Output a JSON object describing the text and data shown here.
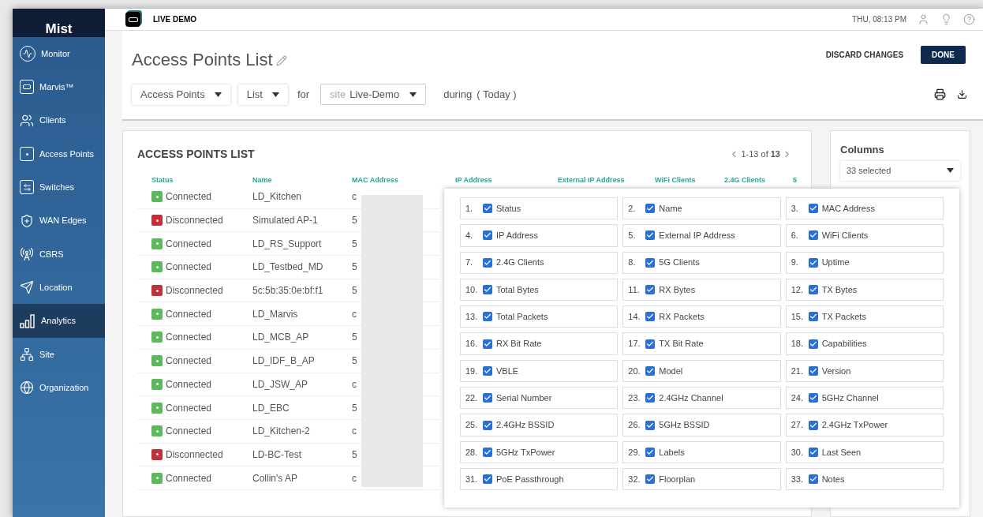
{
  "sidebar": {
    "logo": "Mist",
    "items": [
      {
        "label": "Monitor",
        "kind": "pulse",
        "selected": false
      },
      {
        "label": "Marvis™",
        "kind": "robot",
        "selected": false
      },
      {
        "label": "Clients",
        "kind": "users",
        "selected": false
      },
      {
        "label": "Access Points",
        "kind": "device",
        "selected": false
      },
      {
        "label": "Switches",
        "kind": "switch",
        "selected": false
      },
      {
        "label": "WAN Edges",
        "kind": "shield",
        "selected": false
      },
      {
        "label": "CBRS",
        "kind": "tower",
        "selected": false
      },
      {
        "label": "Location",
        "kind": "navigation",
        "selected": false
      },
      {
        "label": "Analytics",
        "kind": "bars",
        "selected": true
      },
      {
        "label": "Site",
        "kind": "sitemap",
        "selected": false
      },
      {
        "label": "Organization",
        "kind": "globe",
        "selected": false
      }
    ]
  },
  "header": {
    "org": "LIVE DEMO",
    "time": "THU, 08:13 PM"
  },
  "report": {
    "title": "Access Points List",
    "discard": "DISCARD CHANGES",
    "done": "DONE",
    "filters": [
      {
        "value": "Access Points"
      },
      {
        "value": "List"
      }
    ],
    "for": "for",
    "site_prefix": "site",
    "site": "Live-Demo",
    "during": "during",
    "period": "( Today )"
  },
  "table": {
    "title": "ACCESS POINTS LIST",
    "pager": "1-13 of",
    "total": "13",
    "columns": [
      "Status",
      "Name",
      "MAC Address",
      "IP Address",
      "External IP Address",
      "WiFi Clients",
      "2.4G Clients",
      "5"
    ],
    "rows": [
      {
        "status": "Connected",
        "online": true,
        "name": "LD_Kitchen",
        "mac": "c"
      },
      {
        "status": "Disconnected",
        "online": false,
        "name": "Simulated AP-1",
        "mac": "5"
      },
      {
        "status": "Connected",
        "online": true,
        "name": "LD_RS_Support",
        "mac": "5"
      },
      {
        "status": "Connected",
        "online": true,
        "name": "LD_Testbed_MD",
        "mac": "5"
      },
      {
        "status": "Disconnected",
        "online": false,
        "name": "5c:5b:35:0e:bf:f1",
        "mac": "5"
      },
      {
        "status": "Connected",
        "online": true,
        "name": "LD_Marvis",
        "mac": "c"
      },
      {
        "status": "Connected",
        "online": true,
        "name": "LD_MCB_AP",
        "mac": "5"
      },
      {
        "status": "Connected",
        "online": true,
        "name": "LD_IDF_B_AP",
        "mac": "5"
      },
      {
        "status": "Connected",
        "online": true,
        "name": "LD_JSW_AP",
        "mac": "c"
      },
      {
        "status": "Connected",
        "online": true,
        "name": "LD_EBC",
        "mac": "5"
      },
      {
        "status": "Connected",
        "online": true,
        "name": "LD_Kitchen-2",
        "mac": "c"
      },
      {
        "status": "Disconnected",
        "online": false,
        "name": "LD-BC-Test",
        "mac": "5"
      },
      {
        "status": "Connected",
        "online": true,
        "name": "Collin's AP",
        "mac": "c"
      }
    ]
  },
  "columns_panel": {
    "title": "Columns",
    "selected_count": "33 selected",
    "options": [
      {
        "number": "1.",
        "label": "Status",
        "checked": true
      },
      {
        "number": "2.",
        "label": "Name",
        "checked": true
      },
      {
        "number": "3.",
        "label": "MAC Address",
        "checked": true
      },
      {
        "number": "4.",
        "label": "IP Address",
        "checked": true
      },
      {
        "number": "5.",
        "label": "External IP Address",
        "checked": true
      },
      {
        "number": "6.",
        "label": "WiFi Clients",
        "checked": true
      },
      {
        "number": "7.",
        "label": "2.4G Clients",
        "checked": true
      },
      {
        "number": "8.",
        "label": "5G Clients",
        "checked": true
      },
      {
        "number": "9.",
        "label": "Uptime",
        "checked": true
      },
      {
        "number": "10.",
        "label": "Total Bytes",
        "checked": true
      },
      {
        "number": "11.",
        "label": "RX Bytes",
        "checked": true
      },
      {
        "number": "12.",
        "label": "TX Bytes",
        "checked": true
      },
      {
        "number": "13.",
        "label": "Total Packets",
        "checked": true
      },
      {
        "number": "14.",
        "label": "RX Packets",
        "checked": true
      },
      {
        "number": "15.",
        "label": "TX Packets",
        "checked": true
      },
      {
        "number": "16.",
        "label": "RX Bit Rate",
        "checked": true
      },
      {
        "number": "17.",
        "label": "TX Bit Rate",
        "checked": true
      },
      {
        "number": "18.",
        "label": "Capabilities",
        "checked": true
      },
      {
        "number": "19.",
        "label": "VBLE",
        "checked": true
      },
      {
        "number": "20.",
        "label": "Model",
        "checked": true
      },
      {
        "number": "21.",
        "label": "Version",
        "checked": true
      },
      {
        "number": "22.",
        "label": "Serial Number",
        "checked": true
      },
      {
        "number": "23.",
        "label": "2.4GHz Channel",
        "checked": true
      },
      {
        "number": "24.",
        "label": "5GHz Channel",
        "checked": true
      },
      {
        "number": "25.",
        "label": "2.4GHz BSSID",
        "checked": true
      },
      {
        "number": "26.",
        "label": "5GHz BSSID",
        "checked": true
      },
      {
        "number": "27.",
        "label": "2.4GHz TxPower",
        "checked": true
      },
      {
        "number": "28.",
        "label": "5GHz TxPower",
        "checked": true
      },
      {
        "number": "29.",
        "label": "Labels",
        "checked": true
      },
      {
        "number": "30.",
        "label": "Last Seen",
        "checked": true
      },
      {
        "number": "31.",
        "label": "PoE Passthrough",
        "checked": true
      },
      {
        "number": "32.",
        "label": "Floorplan",
        "checked": true
      },
      {
        "number": "33.",
        "label": "Notes",
        "checked": true
      }
    ]
  }
}
